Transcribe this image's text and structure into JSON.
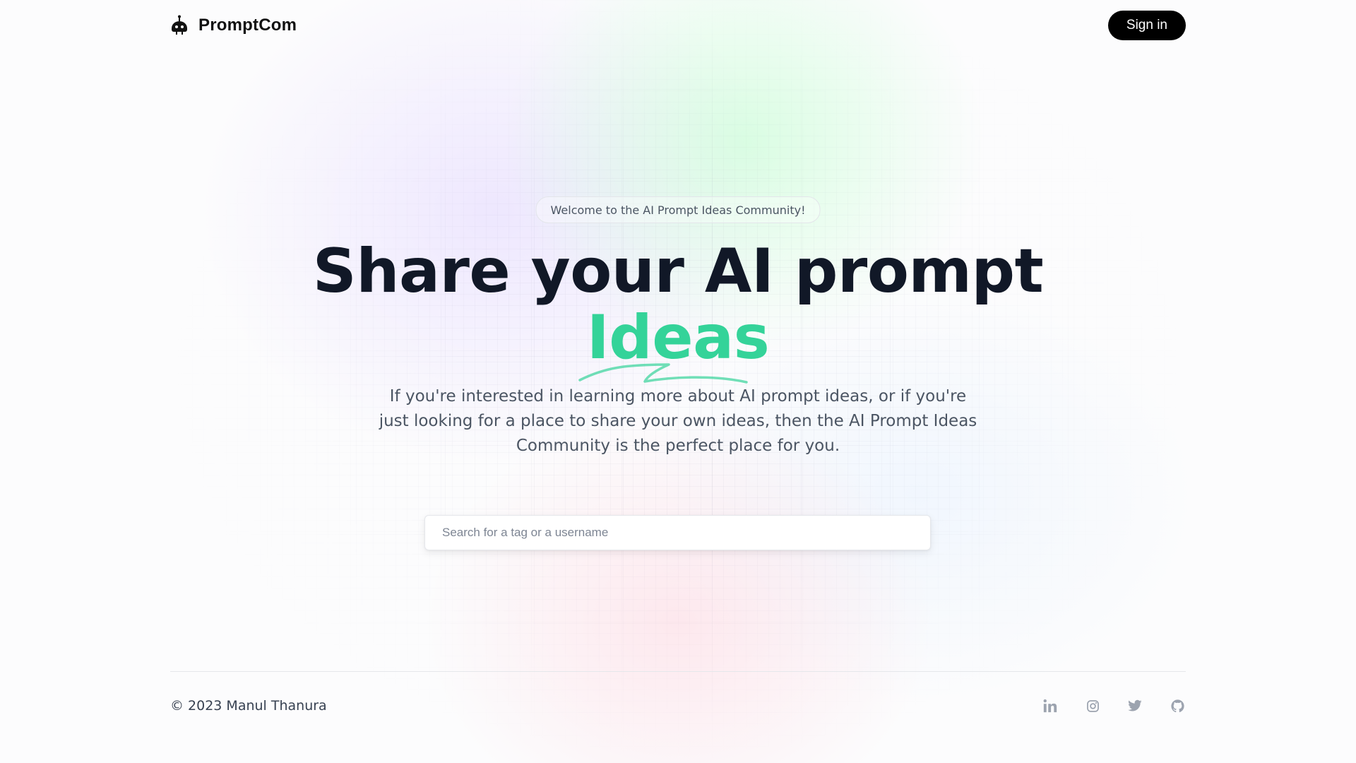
{
  "colors": {
    "accent": "#34d399",
    "text_primary": "#111827",
    "text_secondary": "#4b5563",
    "button_bg": "#000000",
    "button_text": "#ffffff",
    "icon_muted": "#9ca3af"
  },
  "header": {
    "brand": "PromptCom",
    "brand_icon": "robot-icon",
    "signin_label": "Sign in"
  },
  "hero": {
    "badge": "Welcome to the AI Prompt Ideas Community!",
    "headline": "Share your AI prompt",
    "highlight": "Ideas",
    "subtitle": "If you're interested in learning more about AI prompt ideas, or if you're just looking for a place to share your own ideas, then the AI Prompt Ideas Community is the perfect place for you."
  },
  "search": {
    "placeholder": "Search for a tag or a username",
    "value": ""
  },
  "footer": {
    "copyright": "© 2023 Manul Thanura",
    "socials": [
      "linkedin-icon",
      "instagram-icon",
      "twitter-icon",
      "github-icon"
    ]
  }
}
